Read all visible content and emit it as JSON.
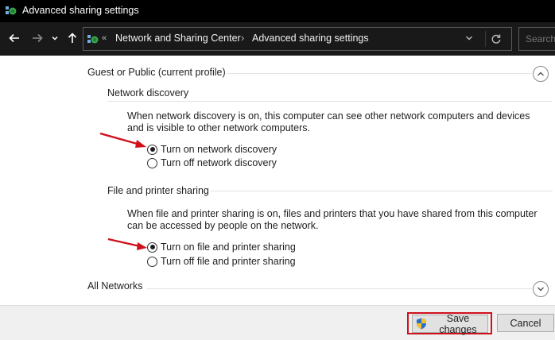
{
  "window": {
    "title": "Advanced sharing settings"
  },
  "nav": {
    "back_icon": "back-arrow-icon",
    "forward_icon": "forward-arrow-icon",
    "recent_icon": "recent-locations-chevron-icon",
    "up_icon": "up-arrow-icon"
  },
  "address": {
    "overflow": "«",
    "crumbs": [
      "Network and Sharing Center",
      "Advanced sharing settings"
    ],
    "separator": "›"
  },
  "search": {
    "placeholder": "Search"
  },
  "profiles": {
    "guest_public": {
      "title": "Guest or Public (current profile)",
      "expanded": true,
      "network_discovery": {
        "title": "Network discovery",
        "description": "When network discovery is on, this computer can see other network computers and devices and is visible to other network computers.",
        "options": [
          {
            "label": "Turn on network discovery",
            "checked": true
          },
          {
            "label": "Turn off network discovery",
            "checked": false
          }
        ]
      },
      "file_printer_sharing": {
        "title": "File and printer sharing",
        "description": "When file and printer sharing is on, files and printers that you have shared from this computer can be accessed by people on the network.",
        "options": [
          {
            "label": "Turn on file and printer sharing",
            "checked": true
          },
          {
            "label": "Turn off file and printer sharing",
            "checked": false
          }
        ]
      }
    },
    "all_networks": {
      "title": "All Networks",
      "expanded": false
    }
  },
  "footer": {
    "save_label": "Save changes",
    "cancel_label": "Cancel"
  },
  "colors": {
    "annotation_red": "#d0101c",
    "titlebar_bg": "#000000",
    "navbar_bg": "#191919"
  }
}
